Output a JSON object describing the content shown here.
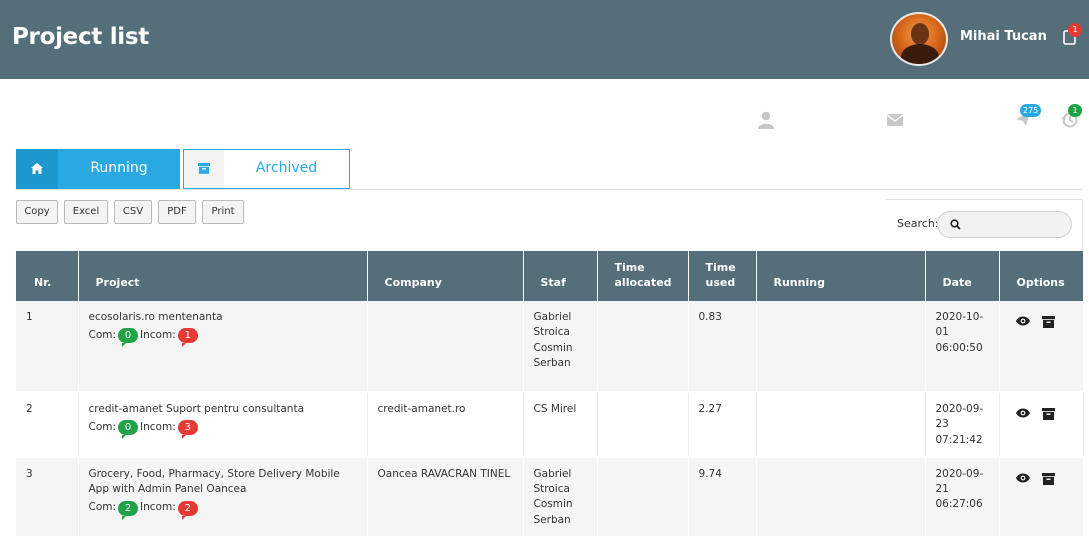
{
  "header": {
    "title": "Project list",
    "user_name": "Mihai Tucan",
    "notification_count": "1"
  },
  "toolbar_icons": {
    "messages_count": "275",
    "history_count": "1"
  },
  "tabs": [
    {
      "label": "Running"
    },
    {
      "label": "Archived"
    }
  ],
  "export_buttons": [
    "Copy",
    "Excel",
    "CSV",
    "PDF",
    "Print"
  ],
  "search": {
    "label": "Search:",
    "value": ""
  },
  "table": {
    "headers": [
      "Nr.",
      "Project",
      "Company",
      "Staf",
      "Time allocated",
      "Time used",
      "Running",
      "Date",
      "Options"
    ],
    "rows": [
      {
        "nr": "1",
        "project": "ecosolaris.ro mentenanta",
        "com_label": "Com:",
        "com": "0",
        "incom_label": "Incom:",
        "incom": "1",
        "company": "",
        "staf": "Gabriel Stroica Cosmin Serban",
        "time_allocated": "",
        "time_used": "0.83",
        "running": "",
        "date": "2020-10-01 06:00:50"
      },
      {
        "nr": "2",
        "project": "credit-amanet Suport pentru consultanta",
        "com_label": "Com:",
        "com": "0",
        "incom_label": "Incom:",
        "incom": "3",
        "company": "credit-amanet.ro",
        "staf": "CS Mirel",
        "time_allocated": "",
        "time_used": "2.27",
        "running": "",
        "date": "2020-09-23 07:21:42"
      },
      {
        "nr": "3",
        "project": "Grocery, Food, Pharmacy, Store Delivery Mobile App with Admin Panel Oancea",
        "com_label": "Com:",
        "com": "2",
        "incom_label": "Incom:",
        "incom": "2",
        "company": "Oancea RAVACRAN TINEL",
        "staf": "Gabriel Stroica Cosmin Serban",
        "time_allocated": "",
        "time_used": "9.74",
        "running": "",
        "date": "2020-09-21 06:27:06"
      }
    ]
  },
  "colors": {
    "header_bg": "#546e7a",
    "accent": "#29a9e1",
    "badge_green": "#1fa346",
    "badge_red": "#e53935"
  }
}
